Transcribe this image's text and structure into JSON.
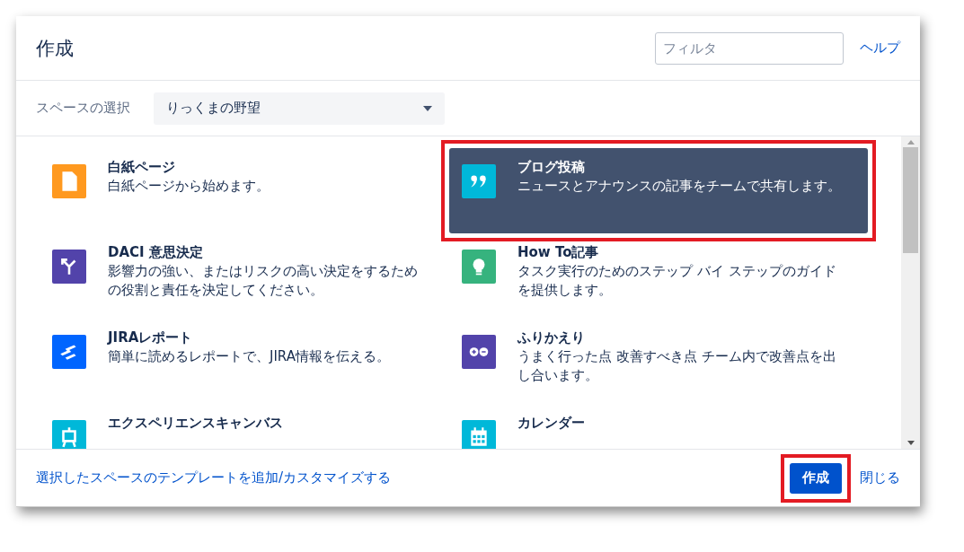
{
  "dialog": {
    "title": "作成",
    "filter": {
      "placeholder": "フィルタ"
    },
    "help_link": "ヘルプ"
  },
  "space_select": {
    "label": "スペースの選択",
    "value": "りっくまの野望"
  },
  "templates": [
    {
      "title": "白紙ページ",
      "description": "白紙ページから始めます。",
      "kind": "page",
      "color": "#ff991f",
      "selected": false,
      "annotated": false
    },
    {
      "title": "ブログ投稿",
      "description": "ニュースとアナウンスの記事をチームで共有します。",
      "kind": "quote",
      "color": "#00b8d9",
      "selected": true,
      "annotated": true
    },
    {
      "title": "DACI 意思決定",
      "description": "影響力の強い、またはリスクの高い決定をするための役割と責任を決定してください。",
      "kind": "fork",
      "color": "#5243aa",
      "selected": false,
      "annotated": false
    },
    {
      "title": "How To記事",
      "description": "タスク実行のためのステップ バイ ステップのガイドを提供します。",
      "kind": "bulb",
      "color": "#36b37e",
      "selected": false,
      "annotated": false
    },
    {
      "title": "JIRAレポート",
      "description": "簡単に読めるレポートで、JIRA情報を伝える。",
      "kind": "jira",
      "color": "#0065ff",
      "selected": false,
      "annotated": false
    },
    {
      "title": "ふりかえり",
      "description": "うまく行った点 改善すべき点 チーム内で改善点を出し合います。",
      "kind": "plusminus",
      "color": "#5243aa",
      "selected": false,
      "annotated": false
    },
    {
      "title": "エクスペリエンスキャンバス",
      "kind": "easel",
      "color": "#00b8d9",
      "selected": false,
      "annotated": false
    },
    {
      "title": "カレンダー",
      "kind": "calendar",
      "color": "#00b8d9",
      "selected": false,
      "annotated": false
    }
  ],
  "footer": {
    "customize_link": "選択したスペースのテンプレートを追加/カスタマイズする",
    "create_button": {
      "label": "作成",
      "annotated": true
    },
    "close_link": "閉じる"
  }
}
